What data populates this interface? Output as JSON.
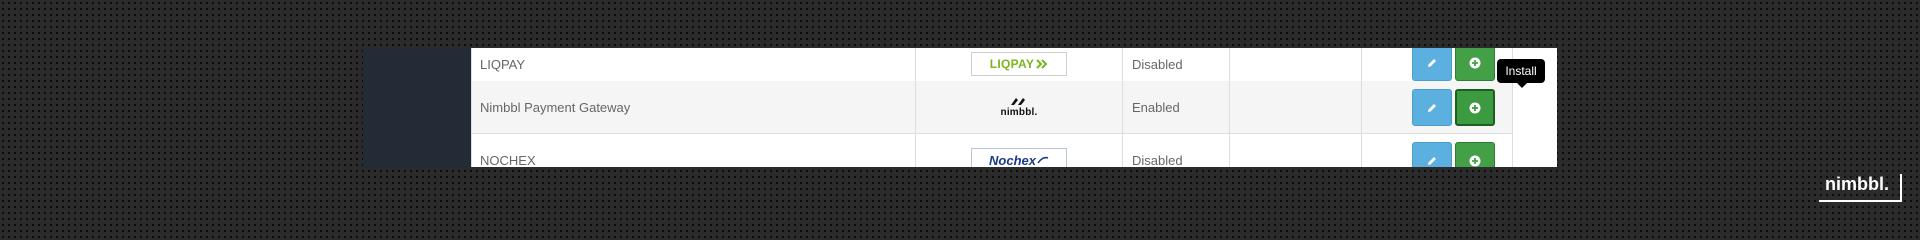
{
  "table": {
    "rows": [
      {
        "name": "LIQPAY",
        "logo_text": "LIQPAY",
        "logo_icon": "double-chevron-right-icon",
        "status": "Disabled"
      },
      {
        "name": "Nimbbl Payment Gateway",
        "logo_text": "nimbbl.",
        "logo_icon": "nimbbl-logo-icon",
        "status": "Enabled"
      },
      {
        "name": "NOCHEX",
        "logo_text": "Nochex",
        "logo_icon": "nochex-swoosh-icon",
        "status": "Disabled"
      }
    ],
    "actions": {
      "edit_icon": "pencil-icon",
      "install_icon": "plus-circle-icon"
    }
  },
  "tooltip": {
    "text": "Install"
  },
  "brand": {
    "text": "nimbbl."
  },
  "colors": {
    "sidebar": "#222b36",
    "edit_button": "#5bb0e0",
    "install_button": "#43a047",
    "liqpay_green": "#7ab51d",
    "nochex_blue": "#1a3a8a"
  }
}
